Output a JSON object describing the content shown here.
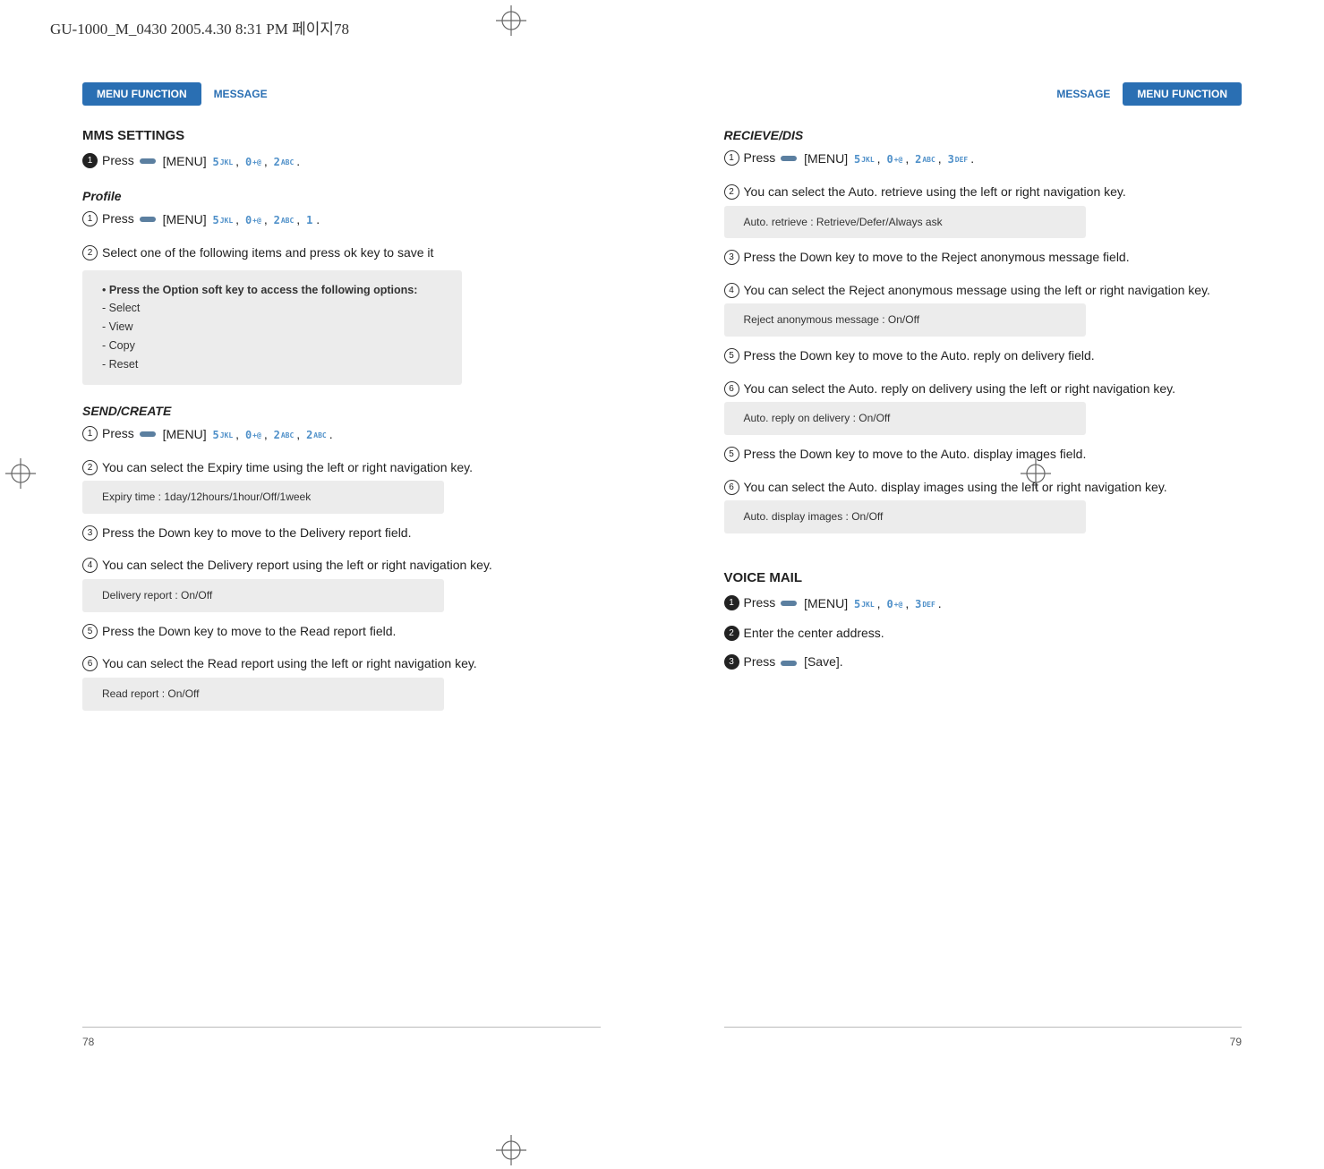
{
  "print_header": "GU-1000_M_0430  2005.4.30 8:31 PM  페이지78",
  "tab_label": "MENU FUNCTION",
  "section_label": "MESSAGE",
  "page_numbers": {
    "left": "78",
    "right": "79"
  },
  "left": {
    "h_mms": "MMS SETTINGS",
    "mms_press": "Press",
    "mms_menu": "[MENU]",
    "mms_keys": [
      "5",
      "0",
      "2"
    ],
    "mms_key_subs": [
      "JKL",
      "+@",
      "ABC"
    ],
    "h_profile": "Profile",
    "prof_press": "Press",
    "prof_menu": "[MENU]",
    "prof_keys": [
      "5",
      "0",
      "2",
      "1"
    ],
    "prof_key_subs": [
      "JKL",
      "+@",
      "ABC",
      ""
    ],
    "prof_sel": "Select one of the following items and press ok key to save it",
    "opt_hd_bullet": "•",
    "opt_hd": "Press the Option soft key to access the following options:",
    "opt1": "- Select",
    "opt2": "- View",
    "opt3": "- Copy",
    "opt4": "- Reset",
    "h_send": "SEND/CREATE",
    "send_press": "Press",
    "send_menu": "[MENU]",
    "send_keys": [
      "5",
      "0",
      "2",
      "2"
    ],
    "send_key_subs": [
      "JKL",
      "+@",
      "ABC",
      "ABC"
    ],
    "send_2": "You can select the Expiry time using the left or right navigation key.",
    "send_box1": "Expiry time : 1day/12hours/1hour/Off/1week",
    "send_3": "Press the Down key to move to the Delivery report field.",
    "send_4": "You can select the Delivery report using the left or right navigation key.",
    "send_box2": "Delivery report : On/Off",
    "send_5": "Press the Down key to move to the Read report field.",
    "send_6": "You can select the Read report using the left or right navigation key.",
    "send_box3": "Read report : On/Off"
  },
  "right": {
    "h_recv": "RECIEVE/DIS",
    "recv_press": "Press",
    "recv_menu": "[MENU]",
    "recv_keys": [
      "5",
      "0",
      "2",
      "3"
    ],
    "recv_key_subs": [
      "JKL",
      "+@",
      "ABC",
      "DEF"
    ],
    "recv_2": "You can select the Auto. retrieve using the left or right navigation key.",
    "recv_box1": "Auto. retrieve : Retrieve/Defer/Always ask",
    "recv_3": "Press the Down key to move to the Reject anonymous message field.",
    "recv_4": "You can select the Reject anonymous message using the left or right navigation key.",
    "recv_box2": "Reject anonymous message : On/Off",
    "recv_5": "Press the Down key to move to the Auto. reply on delivery field.",
    "recv_6": "You can select the Auto. reply on delivery using the left or right navigation key.",
    "recv_box3": "Auto. reply on delivery : On/Off",
    "recv_5b": "Press the Down key to move to the Auto. display images field.",
    "recv_6b": "You can select the Auto. display images using the left or right navigation key.",
    "recv_box4": "Auto. display images : On/Off",
    "h_vm": "VOICE MAIL",
    "vm_press": "Press",
    "vm_menu": "[MENU]",
    "vm_keys": [
      "5",
      "0",
      "3"
    ],
    "vm_key_subs": [
      "JKL",
      "+@",
      "DEF"
    ],
    "vm_2": "Enter the center address.",
    "vm_3": "Press",
    "vm_3_save": "[Save]."
  }
}
